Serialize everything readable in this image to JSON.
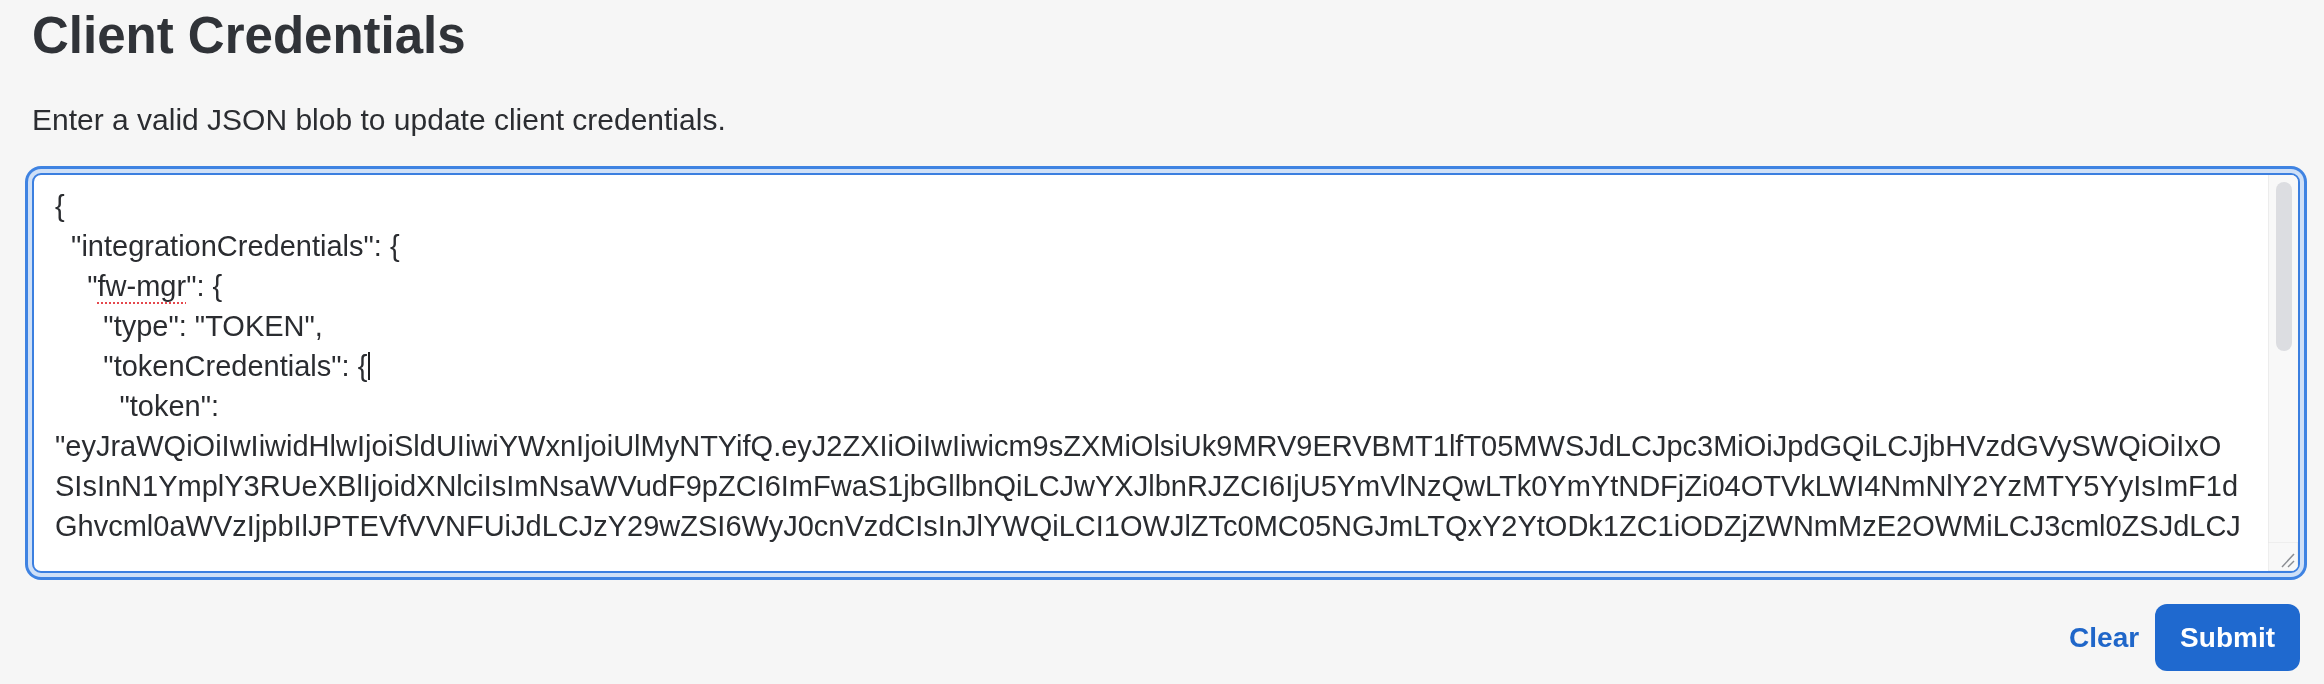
{
  "page": {
    "title": "Client Credentials",
    "description": "Enter a valid JSON blob to update client credentials."
  },
  "editor": {
    "focused": true,
    "lines": [
      {
        "text": "{",
        "caret": false
      },
      {
        "text": "  \"integrationCredentials\": {",
        "caret": false
      },
      {
        "parts": [
          {
            "text": "    \"",
            "misspelled": false
          },
          {
            "text": "fw-mgr",
            "misspelled": true
          },
          {
            "text": "\": {",
            "misspelled": false
          }
        ],
        "caret": false
      },
      {
        "text": "      \"type\": \"TOKEN\",",
        "caret": false
      },
      {
        "text": "      \"tokenCredentials\": {",
        "caret": true
      },
      {
        "text": "        \"token\":",
        "caret": false
      },
      {
        "text": "\"eyJraWQiOiIwIiwidHlwIjoiSldUIiwiYWxnIjoiUlMyNTYifQ.eyJ2ZXIiOiIwIiwicm9sZXMiOlsiUk9MRV9ERVBMT1lfT05MWSJdLCJpc3MiOiJpdGQiLCJjbHVzdGVySWQiOiIxO",
        "caret": false
      },
      {
        "text": "SIsInN1YmplY3RUeXBlIjoidXNlciIsImNsaWVudF9pZCI6ImFwaS1jbGllbnQiLCJwYXJlbnRJZCI6IjU5YmVlNzQwLTk0YmYtNDFjZi04OTVkLWI4NmNlY2YzMTY5YyIsImF1d",
        "caret": false
      },
      {
        "text": "Ghvcml0aWVzIjpbIlJPTEVfVVNFUiJdLCJzY29wZSI6WyJ0cnVzdCIsInJlYWQiLCI1OWJlZTc0MC05NGJmLTQxY2YtODk1ZC1iODZjZWNmMzE2OWMiLCJ3cml0ZSJdLCJ",
        "caret": false
      }
    ]
  },
  "buttons": [
    {
      "label": "Clear",
      "kind": "link"
    },
    {
      "label": "Submit",
      "kind": "primary"
    }
  ]
}
